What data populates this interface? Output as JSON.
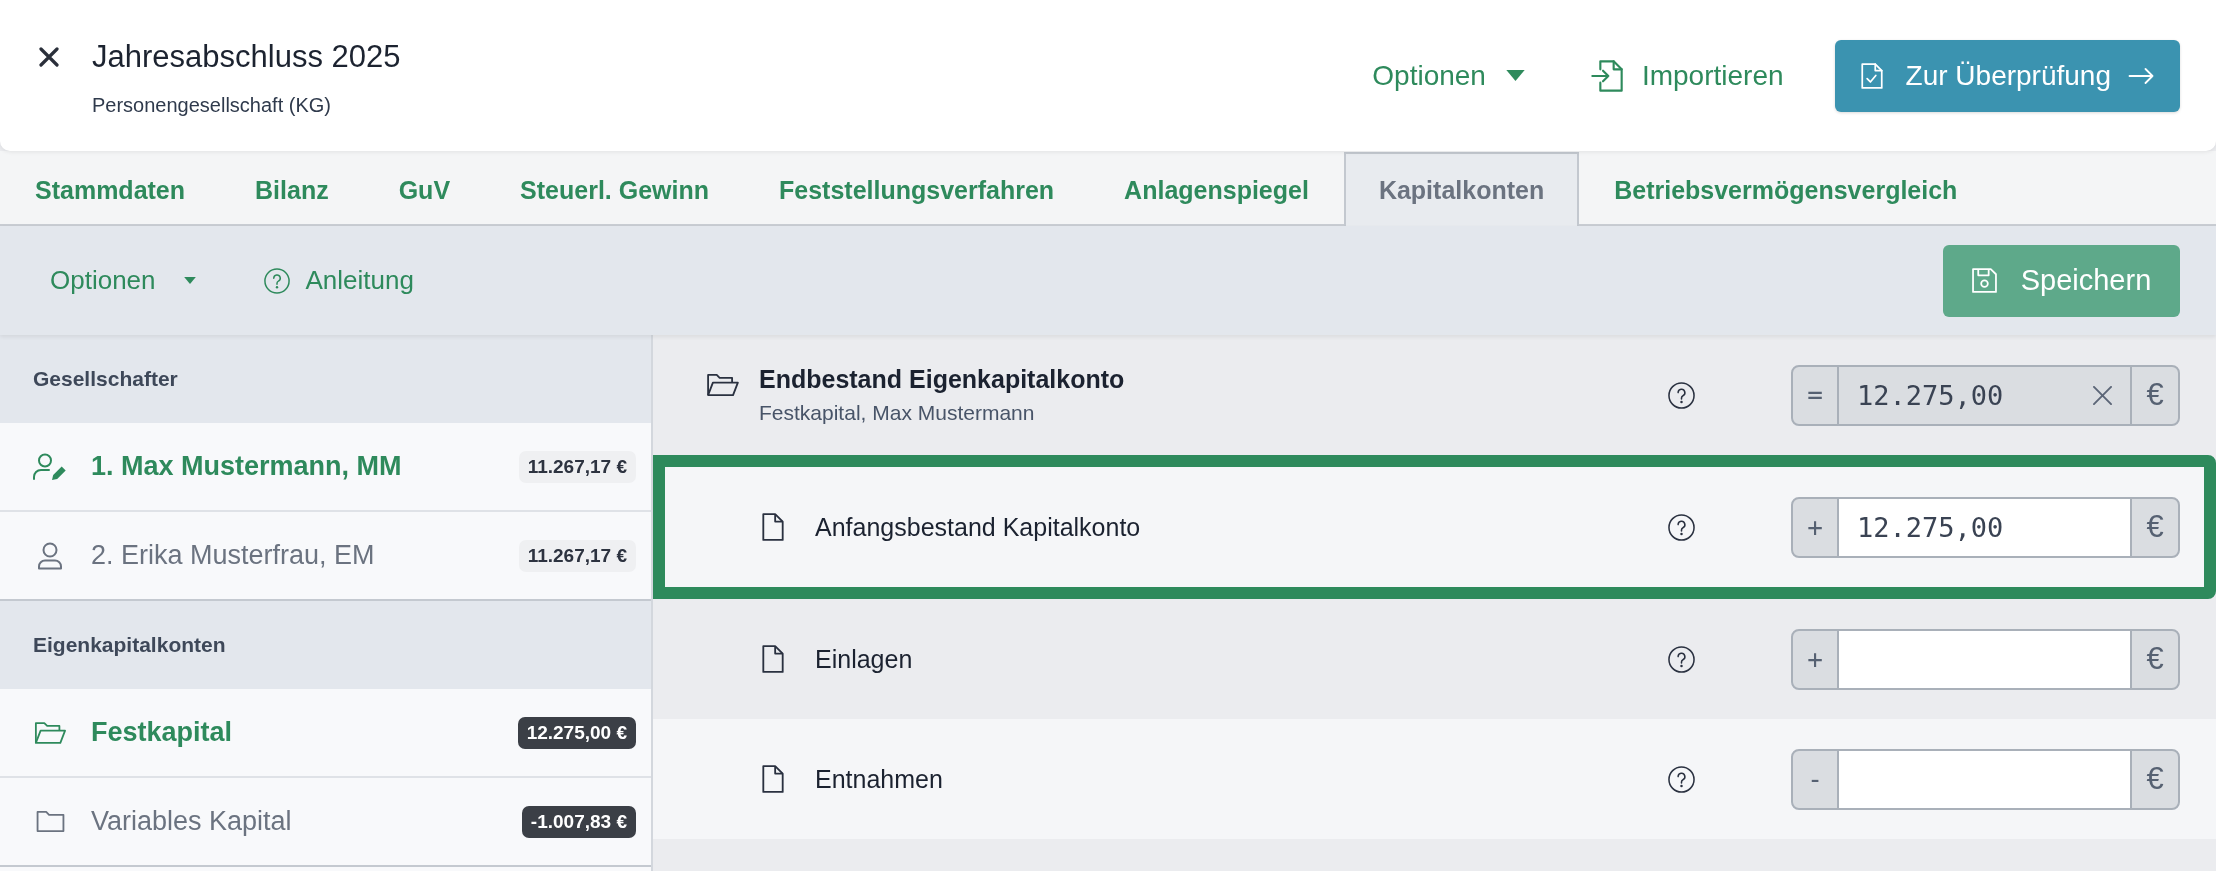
{
  "header": {
    "title": "Jahresabschluss 2025",
    "subtitle": "Personengesellschaft (KG)",
    "options_menu": "Optionen",
    "import_button": "Importieren",
    "review_button": "Zur Überprüfung"
  },
  "tabs": [
    {
      "label": "Stammdaten",
      "selected": false
    },
    {
      "label": "Bilanz",
      "selected": false
    },
    {
      "label": "GuV",
      "selected": false
    },
    {
      "label": "Steuerl. Gewinn",
      "selected": false
    },
    {
      "label": "Feststellungsverfahren",
      "selected": false
    },
    {
      "label": "Anlagenspiegel",
      "selected": false
    },
    {
      "label": "Kapitalkonten",
      "selected": true
    },
    {
      "label": "Betriebsvermögensvergleich",
      "selected": false
    }
  ],
  "toolbar": {
    "options_menu": "Optionen",
    "guide_link": "Anleitung",
    "save_button": "Speichern"
  },
  "sidebar": {
    "sections": [
      {
        "title": "Gesellschafter",
        "items": [
          {
            "kind": "person",
            "label": "1. Max Mustermann, MM",
            "amount": "11.267,17 €",
            "selected": true
          },
          {
            "kind": "person",
            "label": "2. Erika Musterfrau, EM",
            "amount": "11.267,17 €",
            "selected": false
          }
        ]
      },
      {
        "title": "Eigenkapitalkonten",
        "items": [
          {
            "kind": "account",
            "label": "Festkapital",
            "amount": "12.275,00 €",
            "selected": true
          },
          {
            "kind": "account",
            "label": "Variables Kapital",
            "amount": "-1.007,83 €",
            "selected": false
          }
        ]
      }
    ]
  },
  "account": {
    "title": "Endbestand Eigenkapitalkonto",
    "subtitle": "Festkapital, Max Mustermann",
    "field": {
      "operator": "=",
      "value": "12.275,00",
      "currency": "€",
      "readonly": true
    }
  },
  "rows": [
    {
      "label": "Anfangsbestand Kapitalkonto",
      "selected": true,
      "field": {
        "operator": "+",
        "value": "12.275,00",
        "currency": "€",
        "readonly": false
      }
    },
    {
      "label": "Einlagen",
      "selected": false,
      "field": {
        "operator": "+",
        "currency": "€",
        "readonly": false
      }
    },
    {
      "label": "Entnahmen",
      "selected": false,
      "field": {
        "operator": "-",
        "currency": "€",
        "readonly": false
      }
    }
  ]
}
